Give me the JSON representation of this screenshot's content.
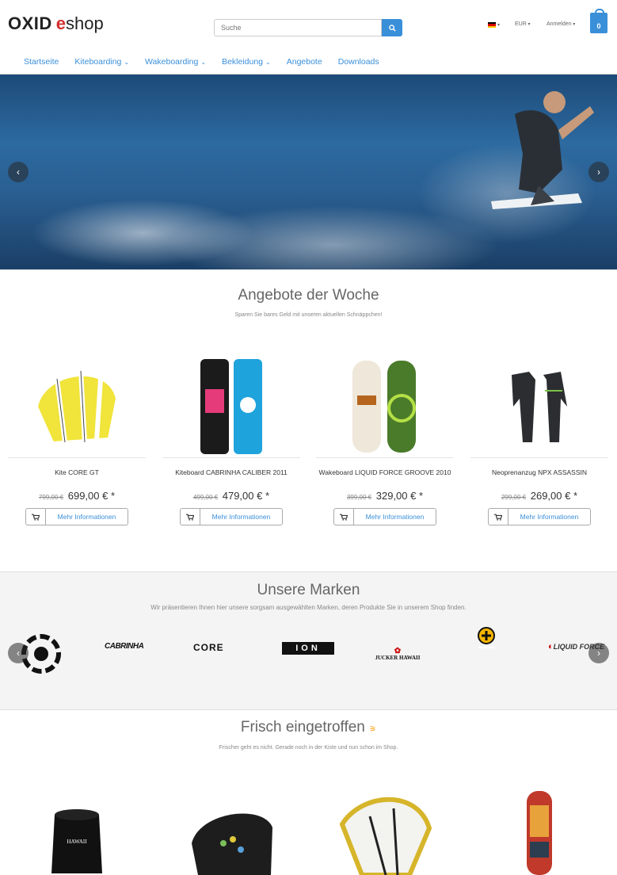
{
  "header": {
    "logo_primary": "OXID",
    "logo_e": "e",
    "logo_secondary": "shop",
    "search_placeholder": "Suche",
    "currency": "EUR",
    "login": "Anmelden",
    "cart_count": "0",
    "accent_color": "#3a8fd9"
  },
  "nav": {
    "items": [
      {
        "label": "Startseite",
        "dropdown": false
      },
      {
        "label": "Kiteboarding",
        "dropdown": true
      },
      {
        "label": "Wakeboarding",
        "dropdown": true
      },
      {
        "label": "Bekleidung",
        "dropdown": true
      },
      {
        "label": "Angebote",
        "dropdown": false
      },
      {
        "label": "Downloads",
        "dropdown": false
      }
    ]
  },
  "offers": {
    "title": "Angebote der Woche",
    "subtitle": "Sparen Sie bares Geld mit unseren aktuellen Schnäppchen!",
    "button_label": "Mehr Informationen",
    "products": [
      {
        "name": "Kite CORE GT",
        "old_price": "799,00 €",
        "price": "699,00 € *"
      },
      {
        "name": "Kiteboard CABRINHA CALIBER 2011",
        "old_price": "499,00 €",
        "price": "479,00 € *"
      },
      {
        "name": "Wakeboard LIQUID FORCE GROOVE 2010",
        "old_price": "399,00 €",
        "price": "329,00 € *"
      },
      {
        "name": "Neoprenanzug NPX ASSASSIN",
        "old_price": "299,00 €",
        "price": "269,00 € *"
      }
    ]
  },
  "brands": {
    "title": "Unsere Marken",
    "subtitle": "Wir präsentieren Ihnen hier unsere sorgsam ausgewählten Marken, deren Produkte Sie in unserem Shop finden.",
    "logos": [
      "CABRINHA",
      "CORE",
      "ION",
      "JUCKER HAWAII",
      "LIQUID FORCE"
    ]
  },
  "fresh": {
    "title": "Frisch eingetroffen",
    "subtitle": "Frischer geht es nicht. Gerade noch in der Kiste und nun schon im Shop."
  }
}
